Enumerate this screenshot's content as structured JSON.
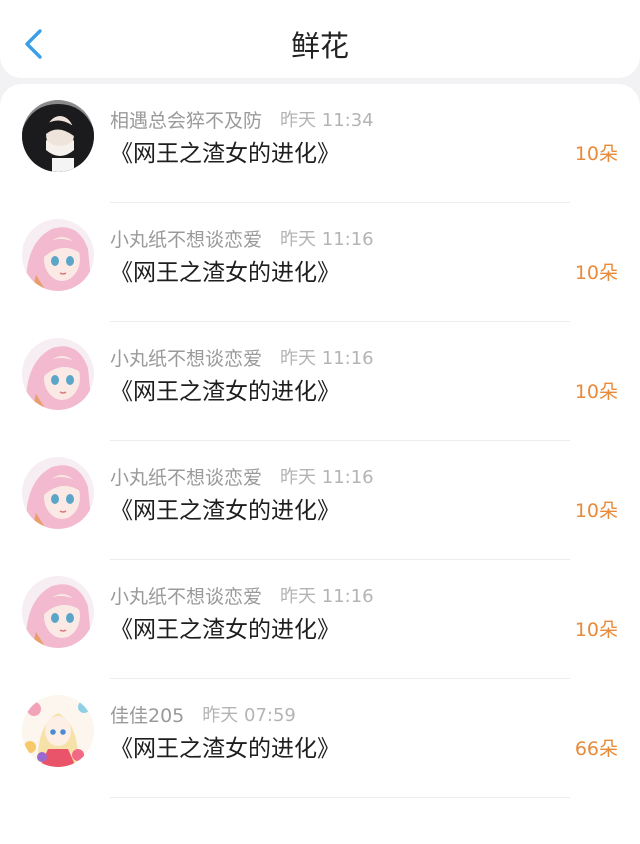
{
  "header": {
    "title": "鲜花",
    "back_icon": "chevron-left-icon",
    "accent": "#3a9ee8"
  },
  "list": {
    "count_color": "#e88a3a",
    "items": [
      {
        "user": "相遇总会猝不及防",
        "time": "昨天 11:34",
        "book": "《网王之渣女的进化》",
        "count": "10朵",
        "avatar": "dark-hair-photo-avatar"
      },
      {
        "user": "小丸纸不想谈恋爱",
        "time": "昨天 11:16",
        "book": "《网王之渣女的进化》",
        "count": "10朵",
        "avatar": "pink-anime-girl-avatar"
      },
      {
        "user": "小丸纸不想谈恋爱",
        "time": "昨天 11:16",
        "book": "《网王之渣女的进化》",
        "count": "10朵",
        "avatar": "pink-anime-girl-avatar"
      },
      {
        "user": "小丸纸不想谈恋爱",
        "time": "昨天 11:16",
        "book": "《网王之渣女的进化》",
        "count": "10朵",
        "avatar": "pink-anime-girl-avatar"
      },
      {
        "user": "小丸纸不想谈恋爱",
        "time": "昨天 11:16",
        "book": "《网王之渣女的进化》",
        "count": "10朵",
        "avatar": "pink-anime-girl-avatar"
      },
      {
        "user": "佳佳205",
        "time": "昨天 07:59",
        "book": "《网王之渣女的进化》",
        "count": "66朵",
        "avatar": "flower-anime-girl-avatar"
      }
    ]
  }
}
